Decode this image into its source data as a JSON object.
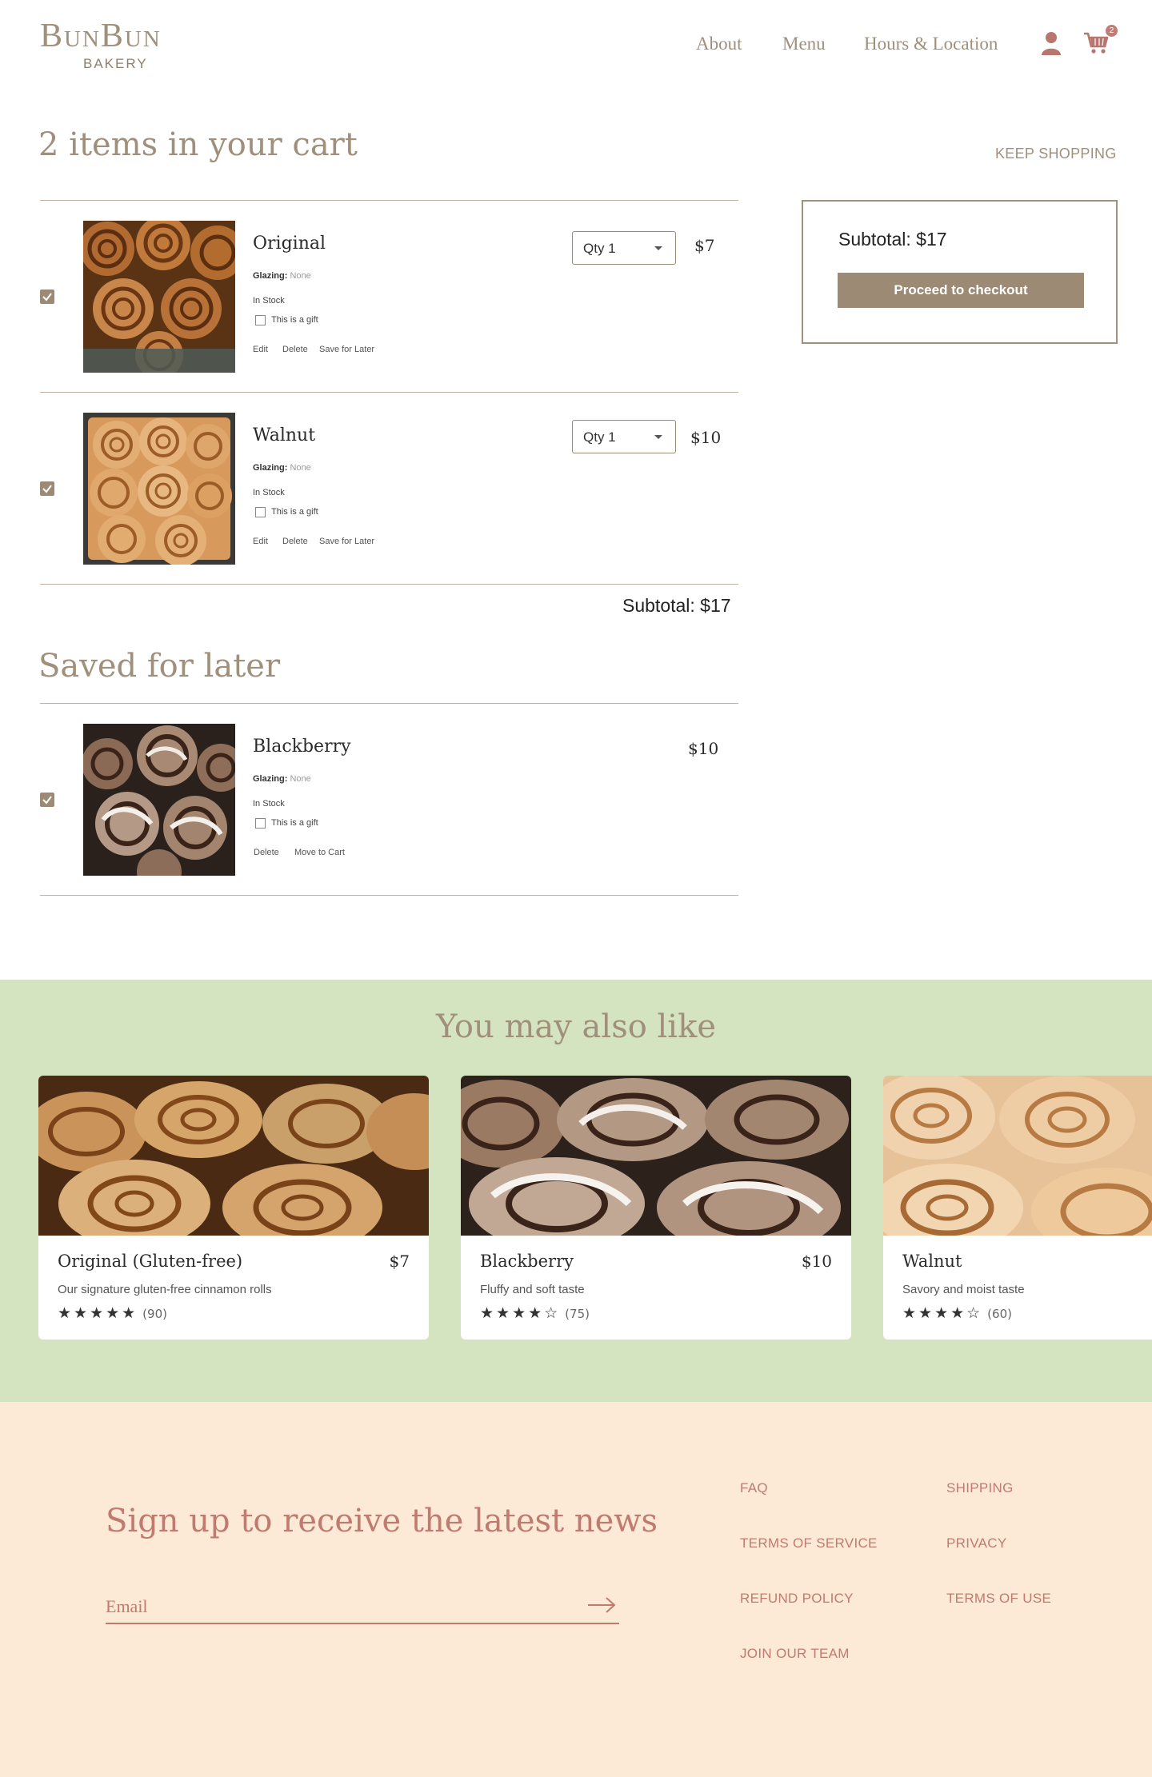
{
  "header": {
    "logo": "BunBun",
    "logo_sub": "BAKERY",
    "nav": [
      "About",
      "Menu",
      "Hours & Location"
    ],
    "cart_count": "2",
    "icons": [
      "user-icon",
      "cart-icon"
    ]
  },
  "cart": {
    "heading": "2 items in your cart",
    "keep_shopping": "KEEP SHOPPING",
    "items": [
      {
        "name": "Original",
        "glazing_label": "Glazing:",
        "glazing_value": "None",
        "stock": "In Stock",
        "gift": "This is a gift",
        "qty": "Qty 1",
        "price": "$7",
        "actions": [
          "Edit",
          "Delete",
          "Save for Later"
        ]
      },
      {
        "name": "Walnut",
        "glazing_label": "Glazing:",
        "glazing_value": "None",
        "stock": "In Stock",
        "gift": "This is a gift",
        "qty": "Qty 1",
        "price": "$10",
        "actions": [
          "Edit",
          "Delete",
          "Save for Later"
        ]
      }
    ],
    "subtotal": "Subtotal: $17"
  },
  "summary": {
    "subtotal": "Subtotal: $17",
    "checkout": "Proceed to checkout"
  },
  "saved": {
    "heading": "Saved for later",
    "items": [
      {
        "name": "Blackberry",
        "glazing_label": "Glazing:",
        "glazing_value": "None",
        "stock": "In Stock",
        "gift": "This is a gift",
        "price": "$10",
        "actions": [
          "Delete",
          "Move to Cart"
        ]
      }
    ]
  },
  "recommendations": {
    "heading": "You may also like",
    "cards": [
      {
        "name": "Original (Gluten-free)",
        "price": "$7",
        "desc": "Our signature gluten-free cinnamon rolls",
        "rating": 5,
        "stars": "★★★★★",
        "count": "(90)"
      },
      {
        "name": "Blackberry",
        "price": "$10",
        "desc": "Fluffy and soft taste",
        "rating": 4,
        "stars": "★★★★☆",
        "count": "(75)"
      },
      {
        "name": "Walnut",
        "price": "",
        "desc": "Savory and moist taste",
        "rating": 4,
        "stars": "★★★★☆",
        "count": "(60)"
      }
    ]
  },
  "footer": {
    "signup": "Sign up to receive the latest news",
    "email_placeholder": "Email",
    "links": [
      "FAQ",
      "SHIPPING",
      "TERMS OF SERVICE",
      "PRIVACY",
      "REFUND POLICY",
      "TERMS OF USE",
      "JOIN OUR TEAM"
    ]
  },
  "colors": {
    "brand_tan": "#a08f7b",
    "button": "#9c8a74",
    "rose": "#c07b71",
    "green_band": "#d5e4c0",
    "footer_bg": "#fce9d6"
  }
}
